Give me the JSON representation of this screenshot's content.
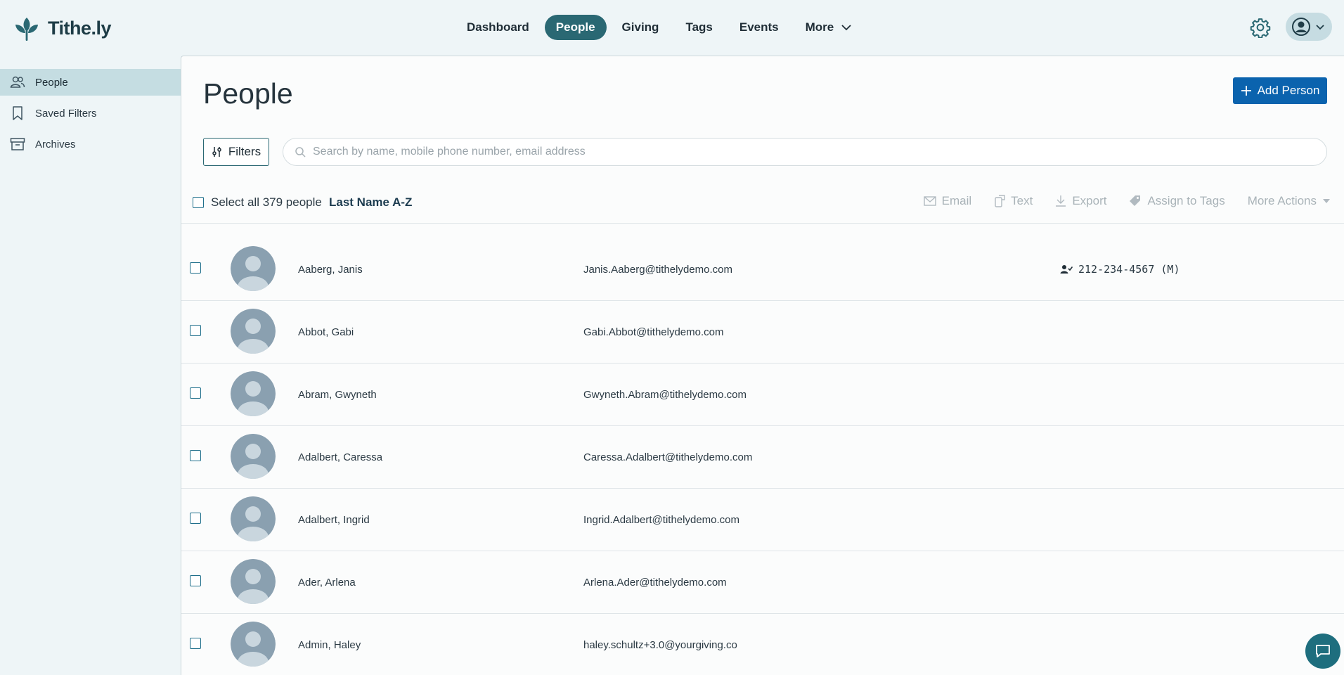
{
  "app": {
    "name": "Tithe.ly"
  },
  "nav": {
    "items": [
      {
        "label": "Dashboard"
      },
      {
        "label": "People"
      },
      {
        "label": "Giving"
      },
      {
        "label": "Tags"
      },
      {
        "label": "Events"
      },
      {
        "label": "More"
      }
    ],
    "active": "People"
  },
  "sidebar": {
    "items": [
      {
        "label": "People",
        "icon": "people-icon"
      },
      {
        "label": "Saved Filters",
        "icon": "bookmark-icon"
      },
      {
        "label": "Archives",
        "icon": "archive-icon"
      }
    ]
  },
  "main": {
    "title": "People",
    "add_button": "Add Person",
    "filters_button": "Filters",
    "search_placeholder": "Search by name, mobile phone number, email address",
    "select_all": "Select all 379 people",
    "sort": "Last Name A-Z",
    "actions": [
      "Email",
      "Text",
      "Export",
      "Assign to Tags",
      "More Actions"
    ]
  },
  "people": [
    {
      "name": "Aaberg, Janis",
      "email": "Janis.Aaberg@tithelydemo.com",
      "phone": "212-234-4567 (M)"
    },
    {
      "name": "Abbot, Gabi",
      "email": "Gabi.Abbot@tithelydemo.com",
      "phone": ""
    },
    {
      "name": "Abram, Gwyneth",
      "email": "Gwyneth.Abram@tithelydemo.com",
      "phone": ""
    },
    {
      "name": "Adalbert, Caressa",
      "email": "Caressa.Adalbert@tithelydemo.com",
      "phone": ""
    },
    {
      "name": "Adalbert, Ingrid",
      "email": "Ingrid.Adalbert@tithelydemo.com",
      "phone": ""
    },
    {
      "name": "Ader, Arlena",
      "email": "Arlena.Ader@tithelydemo.com",
      "phone": ""
    },
    {
      "name": "Admin, Haley",
      "email": "haley.schultz+3.0@yourgiving.co",
      "phone": ""
    }
  ],
  "colors": {
    "accent": "#2a6873",
    "primary_button": "#0b63ae",
    "background": "#eef5f7"
  }
}
